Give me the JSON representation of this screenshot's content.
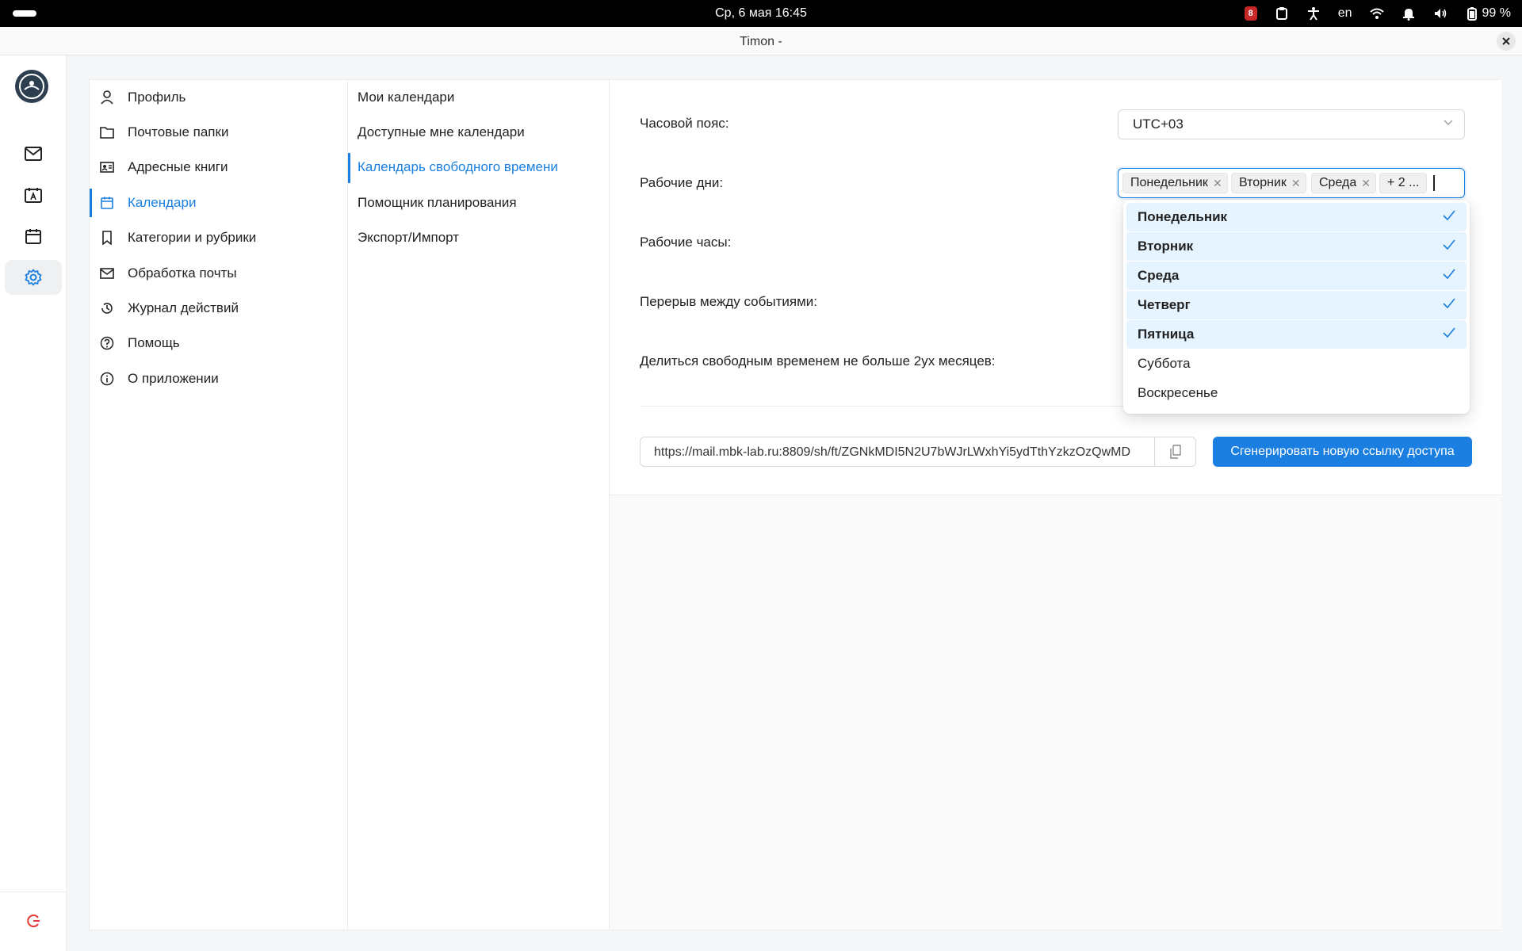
{
  "system_bar": {
    "datetime": "Ср, 6 мая  16:45",
    "notification_count": "8",
    "language": "en",
    "battery": "99 %"
  },
  "window": {
    "title": "Timon -"
  },
  "nav": {
    "items": [
      {
        "label": "Профиль",
        "icon": "user-icon"
      },
      {
        "label": "Почтовые папки",
        "icon": "folder-icon"
      },
      {
        "label": "Адресные книги",
        "icon": "contact-card-icon"
      },
      {
        "label": "Календари",
        "icon": "calendar-icon",
        "active": true
      },
      {
        "label": "Категории и рубрики",
        "icon": "bookmark-icon"
      },
      {
        "label": "Обработка почты",
        "icon": "mail-icon"
      },
      {
        "label": "Журнал действий",
        "icon": "history-icon"
      },
      {
        "label": "Помощь",
        "icon": "help-icon"
      },
      {
        "label": "О приложении",
        "icon": "info-icon"
      }
    ]
  },
  "subnav": {
    "items": [
      {
        "label": "Мои календари"
      },
      {
        "label": "Доступные мне календари"
      },
      {
        "label": "Календарь свободного времени",
        "active": true
      },
      {
        "label": "Помощник планирования"
      },
      {
        "label": "Экспорт/Импорт"
      }
    ]
  },
  "settings": {
    "timezone_label": "Часовой пояс:",
    "timezone_value": "UTC+03",
    "workdays_label": "Рабочие дни:",
    "workdays_tags": [
      "Понедельник",
      "Вторник",
      "Среда"
    ],
    "workdays_more": "+ 2 ...",
    "workhours_label": "Рабочие часы:",
    "break_label": "Перерыв между событиями:",
    "share_label": "Делиться свободным временем не больше 2ух месяцев:",
    "share_link": "https://mail.mbk-lab.ru:8809/sh/ft/ZGNkMDI5N2U7bWJrLWxhYi5ydTthYzkzOzQwMD",
    "generate_button": "Сгенерировать новую ссылку доступа"
  },
  "dropdown": {
    "options": [
      {
        "label": "Понедельник",
        "selected": true
      },
      {
        "label": "Вторник",
        "selected": true
      },
      {
        "label": "Среда",
        "selected": true
      },
      {
        "label": "Четверг",
        "selected": true
      },
      {
        "label": "Пятница",
        "selected": true
      },
      {
        "label": "Суббота",
        "selected": false
      },
      {
        "label": "Воскресенье",
        "selected": false
      }
    ]
  },
  "colors": {
    "accent": "#1a7fe0",
    "selected_bg": "#e6f4ff",
    "logout": "#e53935"
  }
}
